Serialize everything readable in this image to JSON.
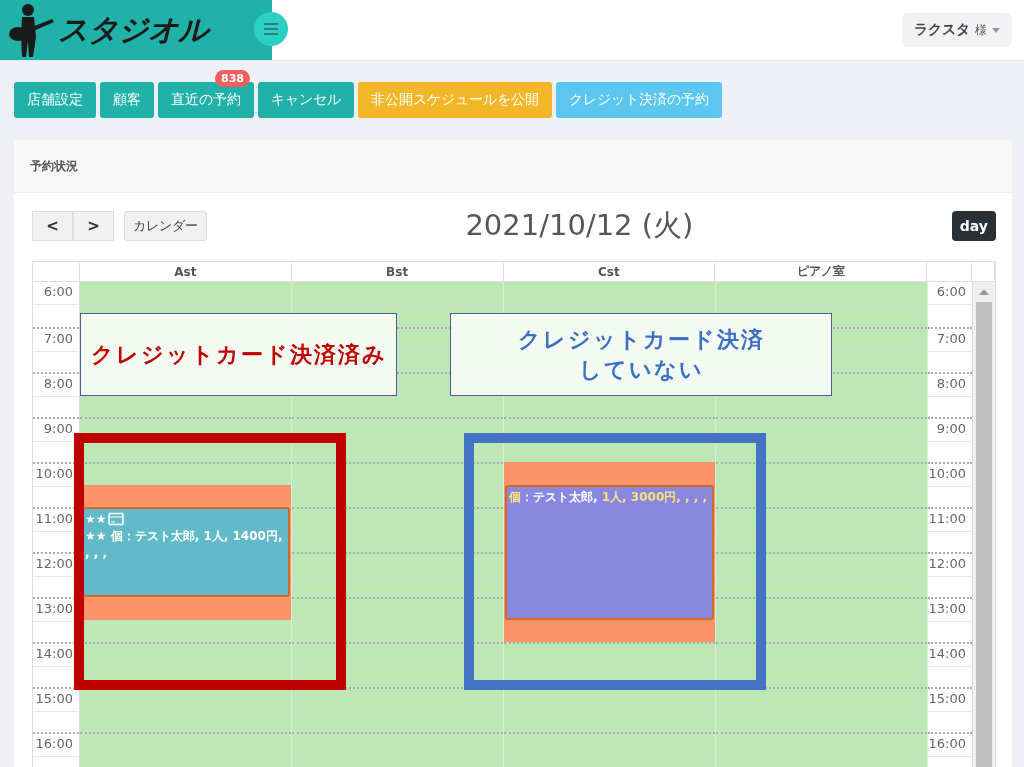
{
  "header": {
    "logo": "スタジオル",
    "user": {
      "name": "ラクスタ",
      "suffix": "様"
    }
  },
  "actions": [
    {
      "label": "店舗設定",
      "kind": "primary"
    },
    {
      "label": "顧客",
      "kind": "primary"
    },
    {
      "label": "直近の予約",
      "kind": "primary",
      "badge": "838"
    },
    {
      "label": "キャンセル",
      "kind": "primary"
    },
    {
      "label": "非公開スケジュールを公開",
      "kind": "warning"
    },
    {
      "label": "クレジット決済の予約",
      "kind": "info"
    }
  ],
  "panel": {
    "title": "予約状況"
  },
  "calendar": {
    "prev": "<",
    "next": ">",
    "today_button": "カレンダー",
    "title": "2021/10/12 (火)",
    "view": "day",
    "times_left": [
      "6:00",
      "7:00",
      "8:00",
      "9:00",
      "10:00",
      "11:00",
      "12:00",
      "13:00",
      "14:00",
      "15:00",
      "16:00"
    ],
    "times_right": [
      "6:00",
      "7:00",
      "8:00",
      "9:00",
      "10:00",
      "11:00",
      "12:00",
      "13:00",
      "14:00",
      "15:00",
      "16:00"
    ],
    "resources": [
      {
        "name": "Ast",
        "events": [
          {
            "kind": "paid",
            "prefix": "★★",
            "parts": [
              {
                "text": "★★ 個：テスト太郎, 1人, 1400円, , , ,",
                "highlight": false
              }
            ]
          }
        ]
      },
      {
        "name": "Bst"
      },
      {
        "name": "Cst",
        "events": [
          {
            "kind": "unpaid",
            "parts": [
              {
                "text": "個",
                "highlight": true
              },
              {
                "text": "：テスト太郎, ",
                "highlight": false
              },
              {
                "text": "1人, 3000円, , , ,",
                "highlight": true
              }
            ]
          }
        ]
      },
      {
        "name": "ピアノ室"
      }
    ]
  },
  "annotations": [
    {
      "kind": "paid",
      "text": "クレジットカード決済済み"
    },
    {
      "kind": "unpaid",
      "text": "クレジットカード決済していない"
    }
  ]
}
